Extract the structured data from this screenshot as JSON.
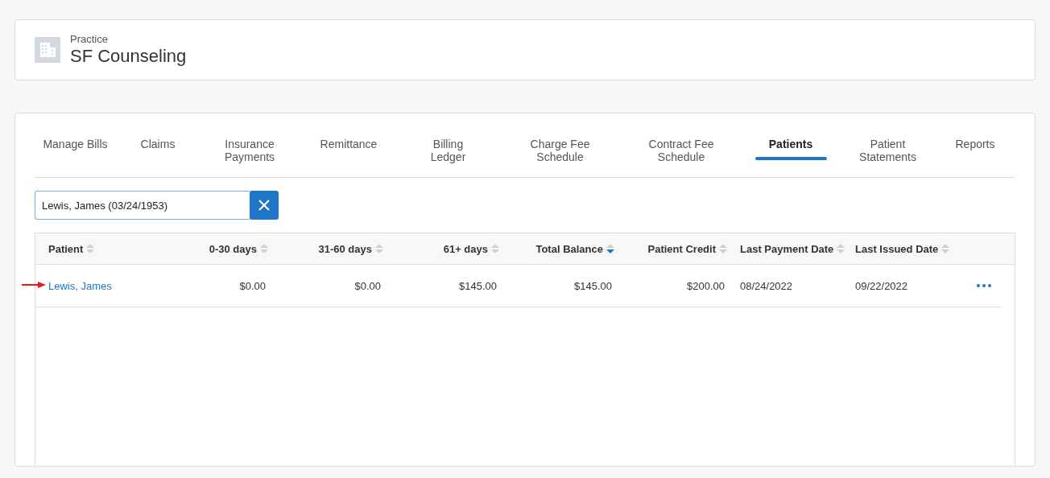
{
  "header": {
    "label": "Practice",
    "title": "SF Counseling"
  },
  "tabs": [
    {
      "label": "Manage Bills",
      "selected": false
    },
    {
      "label": "Claims",
      "selected": false
    },
    {
      "label": "Insurance Payments",
      "selected": false
    },
    {
      "label": "Remittance",
      "selected": false
    },
    {
      "label": "Billing Ledger",
      "selected": false
    },
    {
      "label": "Charge Fee Schedule",
      "selected": false
    },
    {
      "label": "Contract Fee Schedule",
      "selected": false
    },
    {
      "label": "Patients",
      "selected": true
    },
    {
      "label": "Patient Statements",
      "selected": false
    },
    {
      "label": "Reports",
      "selected": false
    }
  ],
  "search": {
    "value": "Lewis, James (03/24/1953)"
  },
  "table": {
    "columns": [
      {
        "label": "Patient",
        "kind": "text",
        "sorted": false
      },
      {
        "label": "0-30 days",
        "kind": "amount",
        "sorted": false
      },
      {
        "label": "31-60 days",
        "kind": "amount",
        "sorted": false
      },
      {
        "label": "61+ days",
        "kind": "amount",
        "sorted": false
      },
      {
        "label": "Total Balance",
        "kind": "amount",
        "sorted": true
      },
      {
        "label": "Patient Credit",
        "kind": "amount",
        "sorted": false
      },
      {
        "label": "Last Payment Date",
        "kind": "text",
        "sorted": false
      },
      {
        "label": "Last Issued Date",
        "kind": "text",
        "sorted": false
      }
    ],
    "rows": [
      {
        "cells": [
          "Lewis, James",
          "$0.00",
          "$0.00",
          "$145.00",
          "$145.00",
          "$200.00",
          "08/24/2022",
          "09/22/2022"
        ]
      }
    ]
  }
}
